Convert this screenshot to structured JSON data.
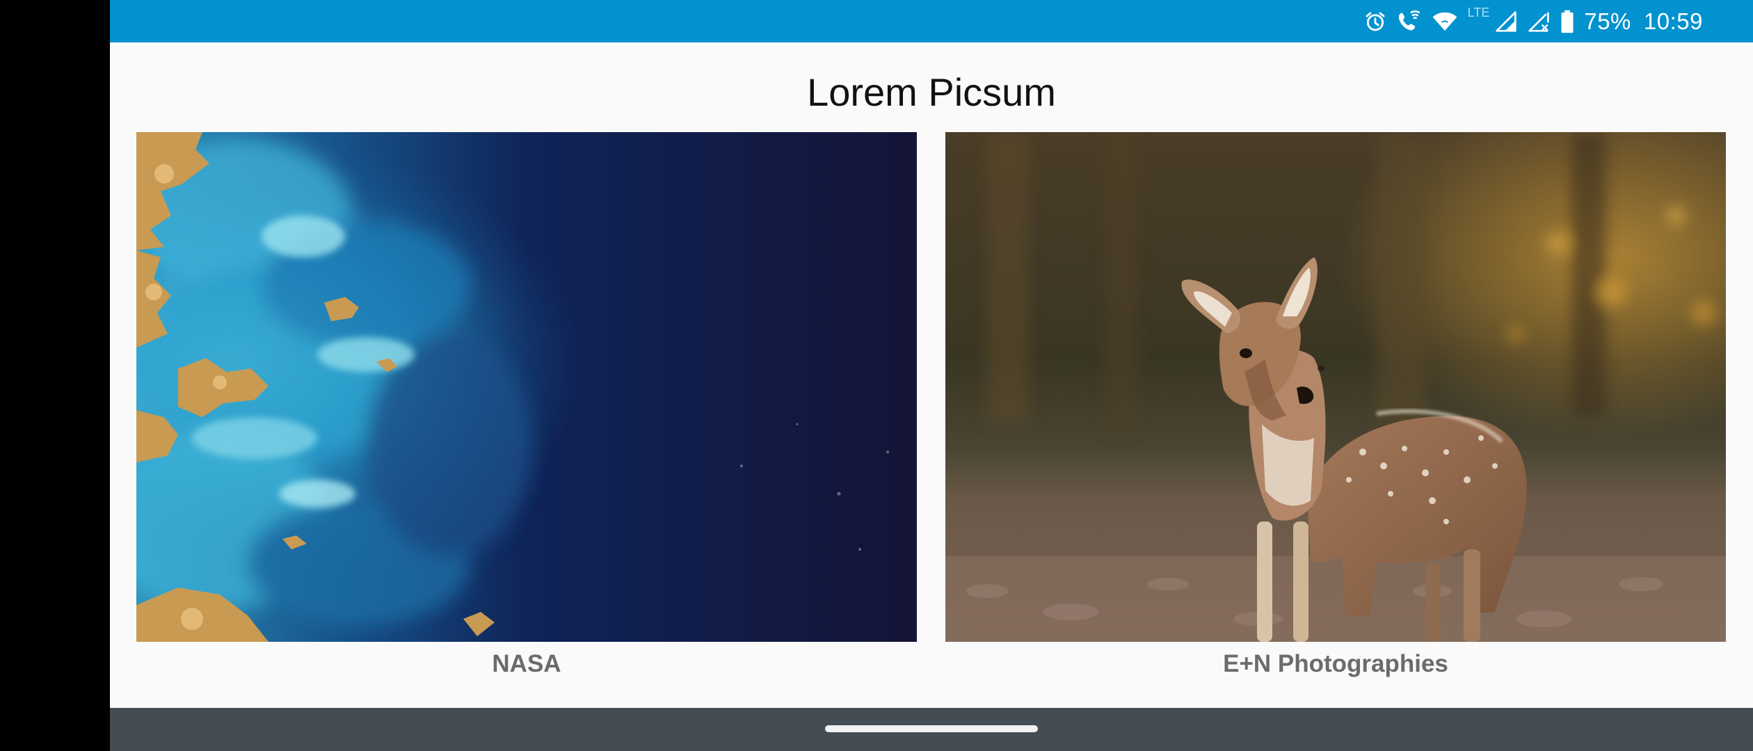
{
  "status_bar": {
    "lte": "LTE",
    "battery": "75%",
    "time": "10:59",
    "icons": [
      "alarm-icon",
      "wifi-calling-icon",
      "wifi-icon",
      "signal-icon",
      "signal-no-service-icon",
      "battery-icon"
    ],
    "background": "#0292cf"
  },
  "page": {
    "title": "Lorem Picsum"
  },
  "photos": [
    {
      "author": "NASA",
      "subject": "satellite view of ocean and islands"
    },
    {
      "author": "E+N Photographies",
      "subject": "young deer in autumn forest"
    }
  ],
  "nav_bar": {
    "background": "#454d54",
    "icons": [
      "home-handle"
    ]
  }
}
